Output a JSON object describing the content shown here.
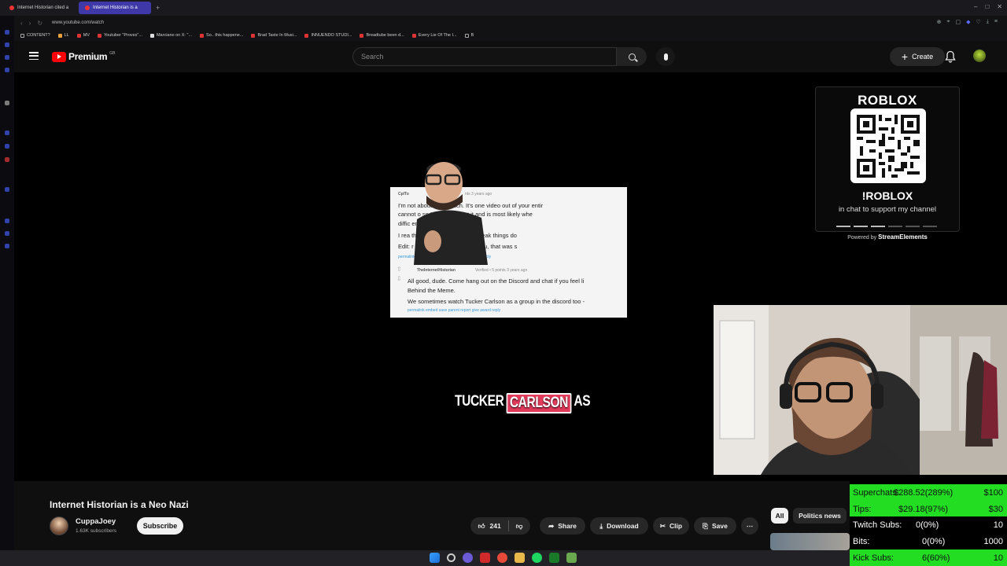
{
  "browser": {
    "tabs": [
      {
        "label": "Internet Historian cited a",
        "active": false
      },
      {
        "label": "Internet Historian is a",
        "active": true
      }
    ],
    "url": "www.youtube.com/watch",
    "bookmarks": [
      "CONTENT?",
      "LL",
      "MV",
      "Youtuber \"Proves\"...",
      "Marciano on X: \"...",
      "So.. this happene...",
      "Brad Taste In Musi...",
      "INNUENDO STUDI...",
      "Breadtube been d...",
      "Every Lie Of The I...",
      "B"
    ]
  },
  "yt_header": {
    "logo_text": "Premium",
    "region": "GB",
    "search_placeholder": "Search",
    "create_label": "Create",
    "icons": [
      "menu-icon",
      "search-icon",
      "mic-icon",
      "plus-icon",
      "bell-icon",
      "avatar"
    ]
  },
  "player": {
    "reddit": {
      "user1": "CplTo",
      "user1_time": "nts 3 years ago",
      "lines1": [
        "I'm not          about it too much. It's one video out of your entir",
        "cannot          o so I bitched about it and is most likely whe",
        "diffic              emotions.",
        "I rea                  the time out to reply and break things do",
        "Edit:                  r disclaimer was disingenuou, that was s"
      ],
      "actions1": "permalink    embed    save    parent    report    give award    reply",
      "user2": "TheInternetHistorian",
      "user2_meta": "Verified  •  5 points 3 years ago",
      "lines2": [
        "All good, dude. Come hang out on the Discord and chat if you feel li",
        "Behind the Meme.",
        "We sometimes watch Tucker Carlson as a group in the discord too -"
      ],
      "actions2": "permalink    embed    save    parent    report    give award    reply"
    },
    "caption": [
      "TUCKER",
      "CARLSON",
      "AS"
    ]
  },
  "roblox_widget": {
    "logo": "ROBLOX",
    "command": "!ROBLOX",
    "subtext": "in chat to support my channel",
    "powered_prefix": "Powered by",
    "powered_brand": "StreamElements"
  },
  "video": {
    "title": "Internet Historian is a Neo Nazi",
    "channel_name": "CuppaJoey",
    "subscribers": "1.63K subscribers",
    "subscribe_label": "Subscribe",
    "likes": "241",
    "share_label": "Share",
    "download_label": "Download",
    "clip_label": "Clip",
    "save_label": "Save",
    "chips": [
      "All",
      "Politics news"
    ]
  },
  "stream_stats": [
    {
      "label": "Superchats:",
      "value": "$288.52(289%)",
      "goal": "$100",
      "highlight": true
    },
    {
      "label": "Tips:",
      "value": "$29.18(97%)",
      "goal": "$30",
      "highlight": true
    },
    {
      "label": "Twitch Subs:",
      "value": "0(0%)",
      "goal": "10",
      "highlight": false
    },
    {
      "label": "Bits:",
      "value": "0(0%)",
      "goal": "1000",
      "highlight": false
    },
    {
      "label": "Kick Subs:",
      "value": "6(60%)",
      "goal": "10",
      "highlight": true
    }
  ],
  "colors": {
    "accent_red": "#ff0000",
    "stat_green": "#22dd22",
    "caption_highlight": "#e23a5b",
    "active_tab": "#3e38a8"
  }
}
